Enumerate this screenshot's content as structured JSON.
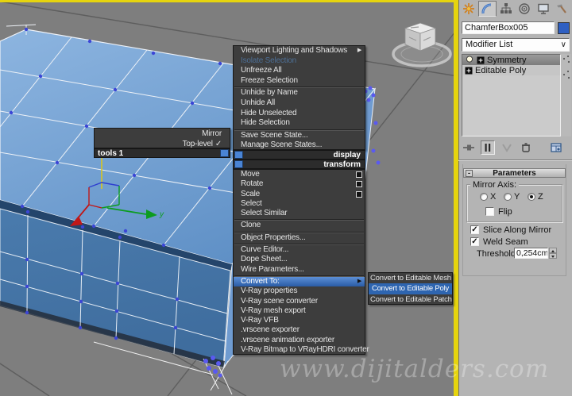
{
  "viewport": {
    "watermark": "www.dijitalders.com",
    "axis_y_label": "y",
    "background": "#7e7e7e",
    "active_border_color": "#e6d40e",
    "object_top_color": "#7fa9d6",
    "object_front_color": "#477cb4"
  },
  "glyphs": {
    "check": "✓",
    "submenu_arrow": "▶",
    "dropdown_arrow": "∨",
    "collapse_minus": "-"
  },
  "quad_menu": {
    "tools_quad": {
      "title": "tools 1",
      "items": [
        {
          "label": "Mirror"
        },
        {
          "label": "Top-level",
          "checked": true
        }
      ]
    },
    "display_quad": {
      "title": "display",
      "items": [
        {
          "label": "Viewport Lighting and Shadows",
          "submenu": true
        },
        {
          "label": "Isolate Selection",
          "disabled": true
        },
        {
          "label": "Unfreeze All"
        },
        {
          "label": "Freeze Selection"
        },
        {
          "label": "Unhide by Name"
        },
        {
          "label": "Unhide All"
        },
        {
          "label": "Hide Unselected"
        },
        {
          "label": "Hide Selection"
        },
        {
          "label": "Save Scene State..."
        },
        {
          "label": "Manage Scene States..."
        }
      ]
    },
    "transform_quad": {
      "title": "transform",
      "items": [
        {
          "label": "Move",
          "settings": true
        },
        {
          "label": "Rotate",
          "settings": true
        },
        {
          "label": "Scale",
          "settings": true
        },
        {
          "label": "Select"
        },
        {
          "label": "Select Similar"
        },
        {
          "label": "Clone"
        },
        {
          "label": "Object Properties..."
        },
        {
          "label": "Curve Editor..."
        },
        {
          "label": "Dope Sheet..."
        },
        {
          "label": "Wire Parameters..."
        },
        {
          "label": "Convert To:",
          "submenu": true,
          "highlighted": true
        },
        {
          "label": "V-Ray properties"
        },
        {
          "label": "V-Ray scene converter"
        },
        {
          "label": "V-Ray mesh export"
        },
        {
          "label": "V-Ray VFB"
        },
        {
          "label": ".vrscene exporter"
        },
        {
          "label": ".vrscene animation exporter"
        },
        {
          "label": "V-Ray Bitmap to VRayHDRI converter"
        }
      ]
    },
    "convert_submenu": {
      "items": [
        {
          "label": "Convert to Editable Mesh"
        },
        {
          "label": "Convert to Editable Poly",
          "highlighted": true
        },
        {
          "label": "Convert to Editable Patch"
        }
      ]
    },
    "highlight_color": "#3a72c2"
  },
  "command_panel": {
    "tabs": [
      {
        "name": "create"
      },
      {
        "name": "modify",
        "active": true
      },
      {
        "name": "hierarchy"
      },
      {
        "name": "motion"
      },
      {
        "name": "display"
      },
      {
        "name": "utilities"
      }
    ],
    "object_name": "ChamferBox005",
    "object_color": "#2e5fc2",
    "modifier_list_label": "Modifier List",
    "modifier_stack": [
      {
        "label": "Symmetry",
        "selected": true
      },
      {
        "label": "Editable Poly"
      }
    ],
    "rollout": {
      "title": "Parameters",
      "mirror_axis_label": "Mirror Axis:",
      "axis_x": "X",
      "axis_y": "Y",
      "axis_z": "Z",
      "selected_axis": "Z",
      "flip_label": "Flip",
      "flip_checked": false,
      "slice_label": "Slice Along Mirror",
      "slice_checked": true,
      "weld_label": "Weld Seam",
      "weld_checked": true,
      "threshold_label": "Threshold:",
      "threshold_value": "0,254cm"
    }
  }
}
